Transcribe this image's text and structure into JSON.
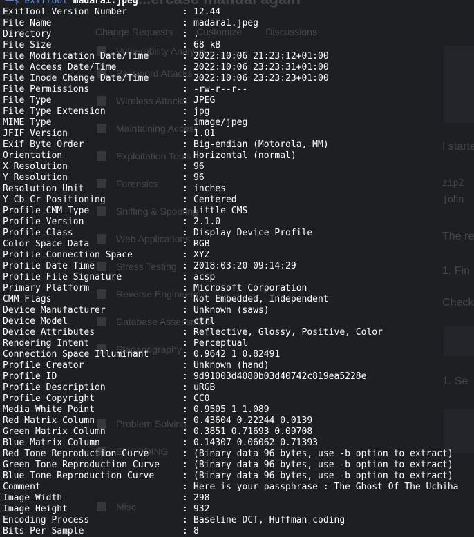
{
  "background": {
    "title": "...ercase manual again",
    "top_nav": [
      "Change Requests",
      "Customize",
      "Discussions"
    ],
    "sidebar": [
      "Vulnerability Analysis",
      "Password Attacks",
      "Wireless Attacks",
      "Maintaining Access",
      "Exploitation Tools",
      "Forensics",
      "Sniffing & Spoofing",
      "Web Applications",
      "Stress Testing",
      "Reverse Engineering",
      "Database Assessment",
      "Steganography",
      "Problem Solving",
      "ENCODING",
      "Misc"
    ],
    "right_texts": [
      "I started",
      "zip2",
      "john",
      "The res",
      "1. Fin",
      "Check",
      "1. Se"
    ]
  },
  "terminal": {
    "prompt_symbol": "└─$",
    "command": "exiftool",
    "argument": "madara1.jpeg",
    "rows": [
      {
        "key": "ExifTool Version Number",
        "value": "12.44"
      },
      {
        "key": "File Name",
        "value": "madara1.jpeg"
      },
      {
        "key": "Directory",
        "value": "."
      },
      {
        "key": "File Size",
        "value": "68 kB"
      },
      {
        "key": "File Modification Date/Time",
        "value": "2022:10:06 21:23:12+01:00"
      },
      {
        "key": "File Access Date/Time",
        "value": "2022:10:06 23:23:31+01:00"
      },
      {
        "key": "File Inode Change Date/Time",
        "value": "2022:10:06 23:23:23+01:00"
      },
      {
        "key": "File Permissions",
        "value": "-rw-r--r--"
      },
      {
        "key": "File Type",
        "value": "JPEG"
      },
      {
        "key": "File Type Extension",
        "value": "jpg"
      },
      {
        "key": "MIME Type",
        "value": "image/jpeg"
      },
      {
        "key": "JFIF Version",
        "value": "1.01"
      },
      {
        "key": "Exif Byte Order",
        "value": "Big-endian (Motorola, MM)"
      },
      {
        "key": "Orientation",
        "value": "Horizontal (normal)"
      },
      {
        "key": "X Resolution",
        "value": "96"
      },
      {
        "key": "Y Resolution",
        "value": "96"
      },
      {
        "key": "Resolution Unit",
        "value": "inches"
      },
      {
        "key": "Y Cb Cr Positioning",
        "value": "Centered"
      },
      {
        "key": "Profile CMM Type",
        "value": "Little CMS"
      },
      {
        "key": "Profile Version",
        "value": "2.1.0"
      },
      {
        "key": "Profile Class",
        "value": "Display Device Profile"
      },
      {
        "key": "Color Space Data",
        "value": "RGB"
      },
      {
        "key": "Profile Connection Space",
        "value": "XYZ"
      },
      {
        "key": "Profile Date Time",
        "value": "2018:03:20 09:14:29"
      },
      {
        "key": "Profile File Signature",
        "value": "acsp"
      },
      {
        "key": "Primary Platform",
        "value": "Microsoft Corporation"
      },
      {
        "key": "CMM Flags",
        "value": "Not Embedded, Independent"
      },
      {
        "key": "Device Manufacturer",
        "value": "Unknown (saws)"
      },
      {
        "key": "Device Model",
        "value": "ctrl"
      },
      {
        "key": "Device Attributes",
        "value": "Reflective, Glossy, Positive, Color"
      },
      {
        "key": "Rendering Intent",
        "value": "Perceptual"
      },
      {
        "key": "Connection Space Illuminant",
        "value": "0.9642 1 0.82491"
      },
      {
        "key": "Profile Creator",
        "value": "Unknown (hand)"
      },
      {
        "key": "Profile ID",
        "value": "9d91003d4080b03d40742c819ea5228e"
      },
      {
        "key": "Profile Description",
        "value": "uRGB"
      },
      {
        "key": "Profile Copyright",
        "value": "CC0"
      },
      {
        "key": "Media White Point",
        "value": "0.9505 1 1.089"
      },
      {
        "key": "Red Matrix Column",
        "value": "0.43604 0.22244 0.0139"
      },
      {
        "key": "Green Matrix Column",
        "value": "0.3851 0.71693 0.09708"
      },
      {
        "key": "Blue Matrix Column",
        "value": "0.14307 0.06062 0.71393"
      },
      {
        "key": "Red Tone Reproduction Curve",
        "value": "(Binary data 96 bytes, use -b option to extract)"
      },
      {
        "key": "Green Tone Reproduction Curve",
        "value": "(Binary data 96 bytes, use -b option to extract)"
      },
      {
        "key": "Blue Tone Reproduction Curve",
        "value": "(Binary data 96 bytes, use -b option to extract)"
      },
      {
        "key": "Comment",
        "value": "Here is your passphrase : The Ghost Of The Uchiha"
      },
      {
        "key": "Image Width",
        "value": "298"
      },
      {
        "key": "Image Height",
        "value": "932"
      },
      {
        "key": "Encoding Process",
        "value": "Baseline DCT, Huffman coding"
      },
      {
        "key": "Bits Per Sample",
        "value": "8"
      }
    ],
    "separator": ":"
  },
  "colors": {
    "background": "#1d1f23",
    "text": "#ffffff",
    "prompt": "#4f7fdb"
  }
}
